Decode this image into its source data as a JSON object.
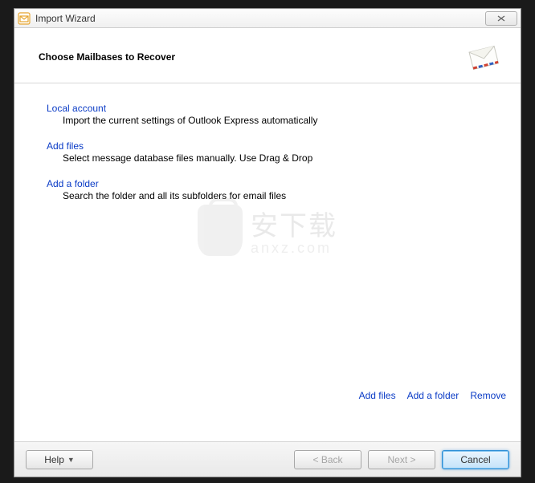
{
  "window": {
    "title": "Import Wizard"
  },
  "header": {
    "title": "Choose Mailbases to Recover"
  },
  "options": [
    {
      "label": "Local account",
      "desc": "Import the current settings of Outlook Express automatically"
    },
    {
      "label": "Add files",
      "desc": "Select message database files manually. Use Drag & Drop"
    },
    {
      "label": "Add a folder",
      "desc": "Search the folder and all its subfolders for email files"
    }
  ],
  "watermark": {
    "cjk": "安下载",
    "latin": "anxz.com"
  },
  "action_links": {
    "add_files": "Add files",
    "add_folder": "Add a folder",
    "remove": "Remove"
  },
  "footer": {
    "help": "Help",
    "back": "< Back",
    "next": "Next >",
    "cancel": "Cancel"
  }
}
